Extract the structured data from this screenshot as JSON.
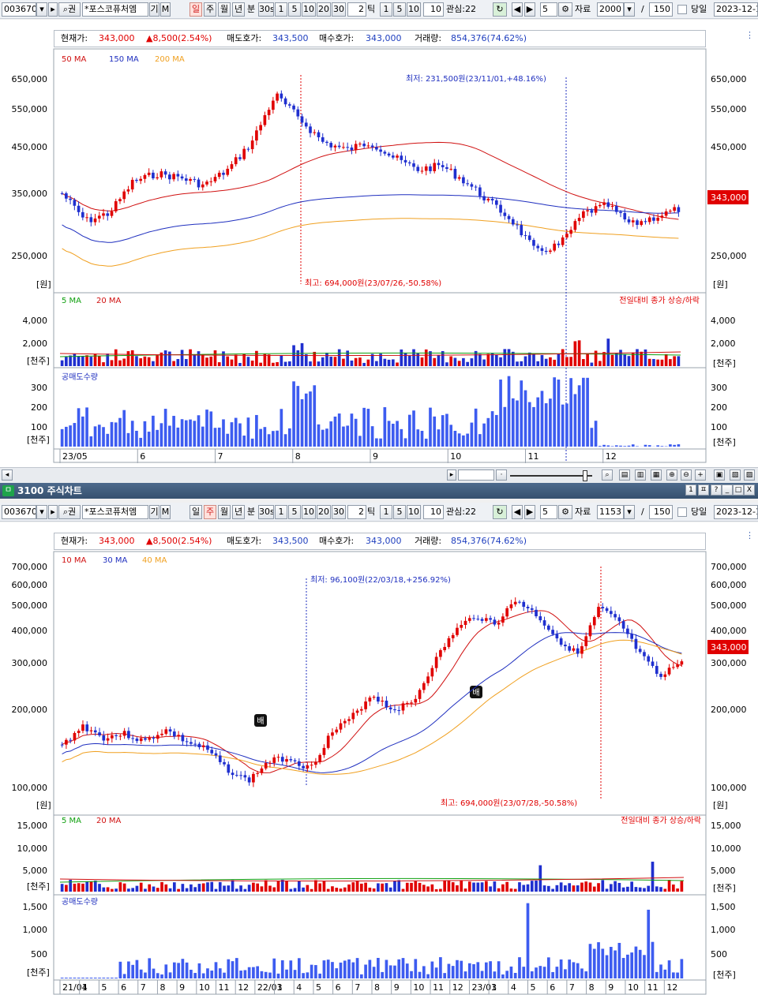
{
  "toolbar": {
    "code": "003670",
    "name": "*포스코퓨처엠",
    "name_btn1": "기",
    "name_btn2": "M",
    "period_buttons": [
      "일",
      "주",
      "월",
      "년"
    ],
    "min_label": "분",
    "min_buttons": [
      "30s",
      "1",
      "5",
      "10",
      "20",
      "30"
    ],
    "tick_value": "2",
    "tick_label": "틱",
    "tick_buttons": [
      "1",
      "5",
      "10"
    ],
    "tick_box": "10",
    "watch_label": "관심:22",
    "watch_extra": "2",
    "count_box": "5",
    "data_label": "자료",
    "data_count_top": "2000",
    "data_count_bottom": "1153",
    "slash": "/",
    "view_count": "150",
    "today_label": "당일",
    "date": "2023-12-1"
  },
  "info": {
    "price_label": "현재가:",
    "price": "343,000",
    "change": "▲8,500(2.54%)",
    "ask_label": "매도호가:",
    "ask": "343,500",
    "bid_label": "매수호가:",
    "bid": "343,000",
    "volume_label": "거래량:",
    "volume": "854,376(74.62%)"
  },
  "daily": {
    "legend": [
      "50 MA",
      "150 MA",
      "200 MA"
    ],
    "legend_colors": [
      "#d01010",
      "#1f2fbf",
      "#f0a020"
    ],
    "yticks": [
      "650,000",
      "550,000",
      "450,000",
      "350,000",
      "250,000"
    ],
    "yunit": "[원]",
    "current_price_tag": "343,000",
    "low_annotation": "최저: 231,500원(23/11/01,+48.16%)",
    "high_annotation": "최고: 694,000원(23/07/26,-50.58%)",
    "vol_legend": [
      "5 MA",
      "20 MA"
    ],
    "vol_legend_colors": [
      "#10a010",
      "#d01010"
    ],
    "vol_note": "전일대비 종가 상승/하락",
    "vol_yticks": [
      "4,000",
      "2,000"
    ],
    "vol_unit": "[천주]",
    "short_legend": "공매도수량",
    "short_yticks": [
      "300",
      "200",
      "100"
    ],
    "short_unit": "[천주]",
    "xticks": [
      "23/05",
      "6",
      "7",
      "8",
      "9",
      "10",
      "11",
      "12"
    ]
  },
  "window": {
    "title": "3100 주식차트",
    "icon_label": "ㅁ",
    "controls": [
      "1",
      "ㅍ",
      "?",
      "_",
      "□",
      "X"
    ]
  },
  "weekly": {
    "legend": [
      "10 MA",
      "30 MA",
      "40 MA"
    ],
    "legend_colors": [
      "#d01010",
      "#1f2fbf",
      "#f0a020"
    ],
    "yticks": [
      "700,000",
      "600,000",
      "500,000",
      "400,000",
      "300,000",
      "200,000",
      "100,000"
    ],
    "yunit": "[원]",
    "current_price_tag": "343,000",
    "low_annotation": "최저: 96,100원(22/03/18,+256.92%)",
    "high_annotation": "최고: 694,000원(23/07/28,-50.58%)",
    "badge": "배",
    "vol_legend": [
      "5 MA",
      "20 MA"
    ],
    "vol_legend_colors": [
      "#10a010",
      "#d01010"
    ],
    "vol_note": "전일대비 종가 상승/하락",
    "vol_yticks": [
      "15,000",
      "10,000",
      "5,000"
    ],
    "vol_unit": "[천주]",
    "short_legend": "공매도수량",
    "short_yticks": [
      "1,500",
      "1,000",
      "500"
    ],
    "short_unit": "[천주]",
    "xticks": [
      "21/01",
      "4",
      "5",
      "6",
      "7",
      "8",
      "9",
      "10",
      "11",
      "12",
      "22/01",
      "3",
      "4",
      "5",
      "6",
      "7",
      "8",
      "9",
      "10",
      "11",
      "12",
      "23/01",
      "3",
      "4",
      "5",
      "6",
      "7",
      "8",
      "9",
      "10",
      "11",
      "12"
    ]
  },
  "colors": {
    "up": "#e00000",
    "down": "#1f2fcf",
    "panel_border": "#b5bcc6",
    "short": "#3d5cf0"
  }
}
